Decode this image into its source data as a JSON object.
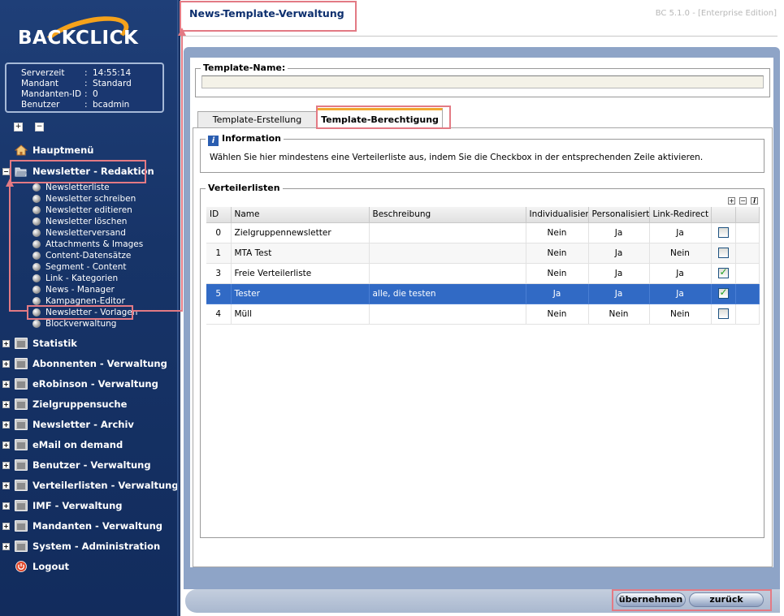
{
  "logo": {
    "text": "BACKCLICK"
  },
  "server_info": {
    "rows": [
      {
        "key": "Serverzeit",
        "value": "14:55:14"
      },
      {
        "key": "Mandant",
        "value": "Standard"
      },
      {
        "key": "Mandanten-ID",
        "value": "0"
      },
      {
        "key": "Benutzer",
        "value": "bcadmin"
      }
    ],
    "separator": ":"
  },
  "tree_controls": {
    "expand": "+",
    "collapse": "−"
  },
  "nav": {
    "hauptmenu": "Hauptmenü",
    "newsletter_redaktion": "Newsletter - Redaktion",
    "sub_items": [
      "Newsletterliste",
      "Newsletter schreiben",
      "Newsletter editieren",
      "Newsletter löschen",
      "Newsletterversand",
      "Attachments & Images",
      "Content-Datensätze",
      "Segment - Content",
      "Link - Kategorien",
      "News - Manager",
      "Kampagnen-Editor",
      "Newsletter - Vorlagen",
      "Blockverwaltung"
    ],
    "sections": [
      "Statistik",
      "Abonnenten - Verwaltung",
      "eRobinson - Verwaltung",
      "Zielgruppensuche",
      "Newsletter - Archiv",
      "eMail on demand",
      "Benutzer - Verwaltung",
      "Verteilerlisten - Verwaltung",
      "IMF - Verwaltung",
      "Mandanten - Verwaltung",
      "System - Administration"
    ],
    "logout": "Logout"
  },
  "header": {
    "title": "News-Template-Verwaltung",
    "version": "BC 5.1.0 - [Enterprise Edition]"
  },
  "template_name": {
    "legend": "Template-Name:",
    "value": ""
  },
  "tabs": [
    "Template-Erstellung",
    "Template-Berechtigung"
  ],
  "information": {
    "legend": "Information",
    "text": "Wählen Sie hier mindestens eine Verteilerliste aus, indem Sie die Checkbox in der entsprechenden Zeile aktivieren."
  },
  "verteilerlisten": {
    "legend": "Verteilerlisten",
    "columns": [
      "ID",
      "Name",
      "Beschreibung",
      "Individualisiert",
      "Personalisiert",
      "Link-Redirect",
      ""
    ],
    "rows": [
      {
        "id": "0",
        "name": "Zielgruppennewsletter",
        "beschreibung": "",
        "individualisiert": "Nein",
        "personalisiert": "Ja",
        "link_redirect": "Ja",
        "checked": false,
        "selected": false
      },
      {
        "id": "1",
        "name": "MTA Test",
        "beschreibung": "",
        "individualisiert": "Nein",
        "personalisiert": "Ja",
        "link_redirect": "Nein",
        "checked": false,
        "selected": false
      },
      {
        "id": "3",
        "name": "Freie Verteilerliste",
        "beschreibung": "",
        "individualisiert": "Nein",
        "personalisiert": "Ja",
        "link_redirect": "Ja",
        "checked": true,
        "selected": false
      },
      {
        "id": "5",
        "name": "Tester",
        "beschreibung": "alle, die testen",
        "individualisiert": "Ja",
        "personalisiert": "Ja",
        "link_redirect": "Ja",
        "checked": true,
        "selected": true
      },
      {
        "id": "4",
        "name": "Müll",
        "beschreibung": "",
        "individualisiert": "Nein",
        "personalisiert": "Nein",
        "link_redirect": "Nein",
        "checked": false,
        "selected": false
      }
    ]
  },
  "buttons": {
    "apply": "übernehmen",
    "back": "zurück"
  }
}
